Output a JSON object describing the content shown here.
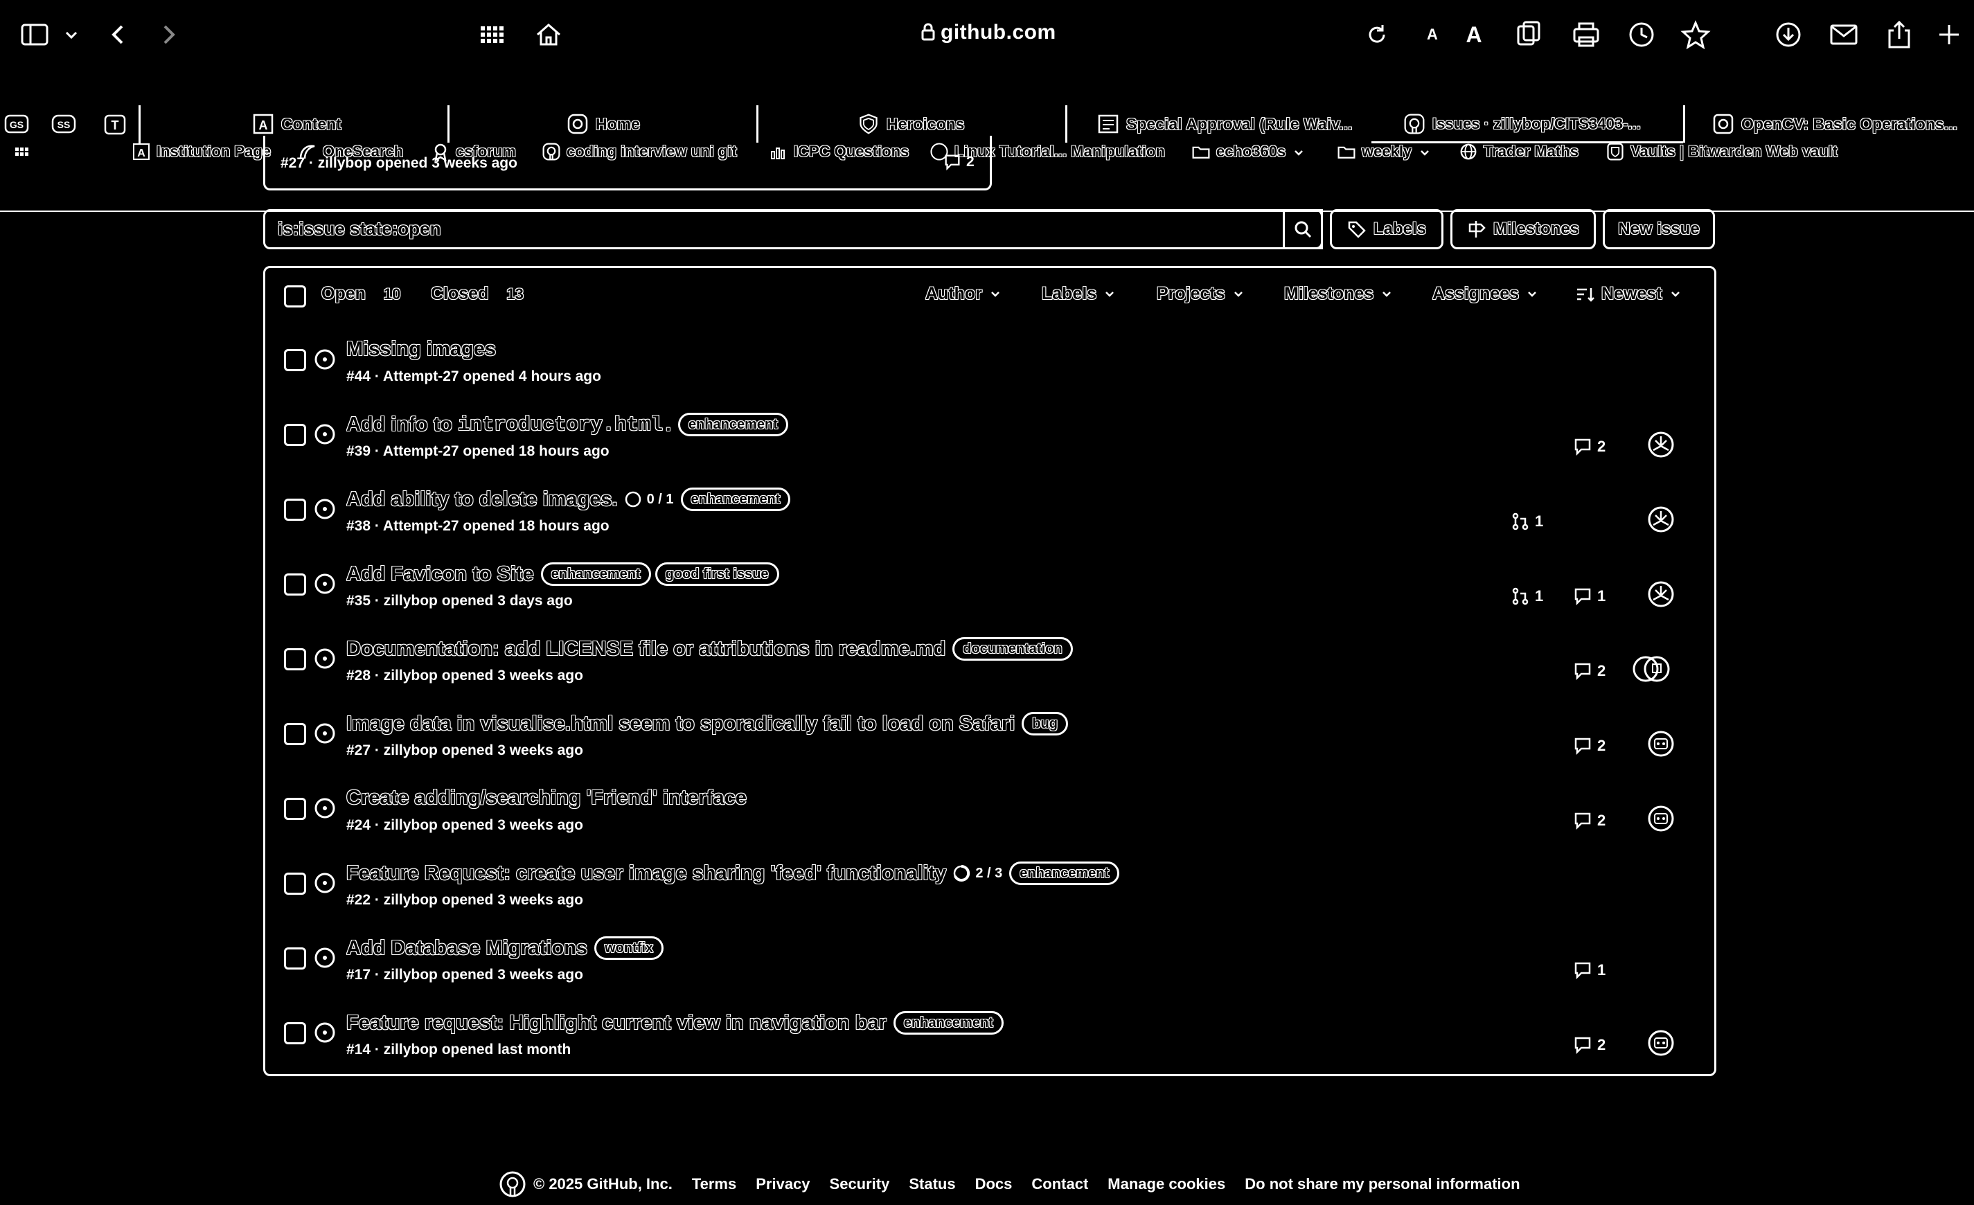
{
  "browser": {
    "url": "github.com",
    "bookmarks": [
      {
        "label": "Institution Page",
        "icon": "a-box-icon"
      },
      {
        "label": "OneSearch",
        "icon": "swirl-icon"
      },
      {
        "label": "csforum",
        "icon": "award-icon"
      },
      {
        "label": "coding interview uni git",
        "icon": "github-icon"
      },
      {
        "label": "ICPC Questions",
        "icon": "bars-icon"
      },
      {
        "label": "Linux Tutorial... Manipulation",
        "icon": "circle-icon"
      },
      {
        "label": "echo360s",
        "icon": "folder-icon"
      },
      {
        "label": "weekly",
        "icon": "folder-icon"
      },
      {
        "label": "Trader Maths",
        "icon": "globe-icon"
      },
      {
        "label": "Vaults | Bitwarden Web vault",
        "icon": "shield-icon"
      }
    ],
    "pinned_tabs": [
      "GS",
      "SS",
      "T"
    ],
    "tabs": [
      {
        "label": "Content",
        "icon": "a-box-icon"
      },
      {
        "label": "Home",
        "icon": "brand-icon"
      },
      {
        "label": "Heroicons",
        "icon": "shield-icon"
      },
      {
        "label": "Special Approval (Rule Waiv...",
        "icon": "form-icon"
      },
      {
        "label": "Issues · zillybop/CITS3403-...",
        "icon": "github-icon"
      },
      {
        "label": "OpenCV: Basic Operations...",
        "icon": "opencv-icon"
      }
    ]
  },
  "pinned_issue": {
    "meta": "#27 · zillybop opened 3 weeks ago",
    "comments": "2"
  },
  "search": {
    "value": "is:issue state:open"
  },
  "buttons": {
    "labels": "Labels",
    "milestones": "Milestones",
    "new_issue": "New issue"
  },
  "list_header": {
    "open_label": "Open",
    "open_count": "10",
    "closed_label": "Closed",
    "closed_count": "13",
    "filters": [
      "Author",
      "Labels",
      "Projects",
      "Milestones",
      "Assignees",
      "Newest"
    ]
  },
  "issues": [
    {
      "title": "Missing images",
      "meta": "#44 · Attempt-27 opened 4 hours ago"
    },
    {
      "title_pre": "Add info to ",
      "title_code": "introductory.html",
      "title_post": ".",
      "label1": "enhancement",
      "meta": "#39 · Attempt-27 opened 18 hours ago",
      "comments": "2"
    },
    {
      "title": "Add ability to delete images.",
      "progress": "0 / 1",
      "label1": "enhancement",
      "meta": "#38 · Attempt-27 opened 18 hours ago",
      "prs": "1"
    },
    {
      "title": "Add Favicon to Site",
      "label1": "enhancement",
      "label2": "good first issue",
      "meta": "#35 · zillybop opened 3 days ago",
      "prs": "1",
      "comments": "1"
    },
    {
      "title": "Documentation: add LICENSE file or attributions in readme.md",
      "label1": "documentation",
      "meta": "#28 · zillybop opened 3 weeks ago",
      "comments": "2"
    },
    {
      "title": "Image data in visualise.html seem to sporadically fail to load on Safari",
      "label1": "bug",
      "meta": "#27 · zillybop opened 3 weeks ago",
      "comments": "2"
    },
    {
      "title": "Create adding/searching 'Friend' interface",
      "meta": "#24 · zillybop opened 3 weeks ago",
      "comments": "2"
    },
    {
      "title": "Feature Request: create user image sharing 'feed' functionality",
      "progress": "2 / 3",
      "label1": "enhancement",
      "meta": "#22 · zillybop opened 3 weeks ago"
    },
    {
      "title": "Add Database Migrations",
      "label1": "wontfix",
      "meta": "#17 · zillybop opened 3 weeks ago",
      "comments": "1"
    },
    {
      "title": "Feature request: Highlight current view in navigation bar",
      "label1": "enhancement",
      "meta": "#14 · zillybop opened last month",
      "comments": "2"
    }
  ],
  "footer": {
    "copyright": "© 2025 GitHub, Inc.",
    "links": [
      "Terms",
      "Privacy",
      "Security",
      "Status",
      "Docs",
      "Contact",
      "Manage cookies",
      "Do not share my personal information"
    ]
  }
}
